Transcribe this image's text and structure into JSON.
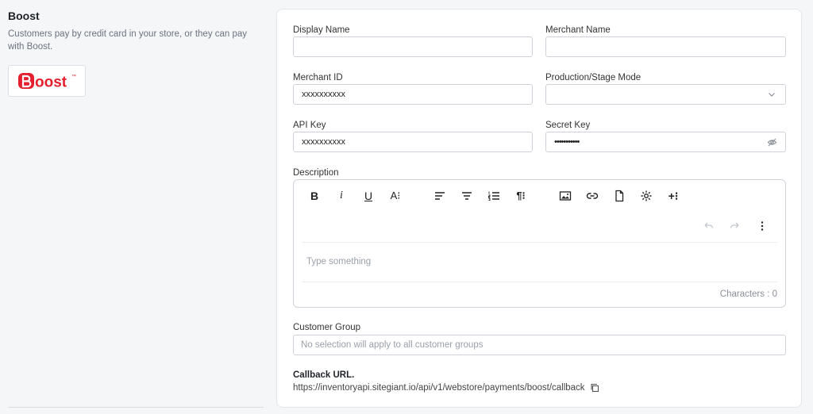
{
  "section": {
    "title": "Boost",
    "description": "Customers pay by credit card in your store, or they can pay with Boost.",
    "logo_text": "oost",
    "logo_tm": "™",
    "brand_color": "#e5202e"
  },
  "form": {
    "display_name": {
      "label": "Display Name",
      "value": ""
    },
    "merchant_name": {
      "label": "Merchant Name",
      "value": ""
    },
    "merchant_id": {
      "label": "Merchant ID",
      "value": "xxxxxxxxxx"
    },
    "mode": {
      "label": "Production/Stage Mode",
      "value": "",
      "icon": "chevron-down-icon"
    },
    "api_key": {
      "label": "API Key",
      "value": "xxxxxxxxxx"
    },
    "secret_key": {
      "label": "Secret Key",
      "value": "•••••••••••",
      "icon": "eye-off-icon"
    },
    "description": {
      "label": "Description",
      "placeholder": "Type something",
      "counter": "Characters : 0",
      "toolbar": [
        "bold-icon",
        "italic-icon",
        "underline-icon",
        "font-size-icon",
        "align-left-icon",
        "align-center-icon",
        "ordered-list-icon",
        "paragraph-icon",
        "image-icon",
        "link-icon",
        "file-icon",
        "settings-icon",
        "insert-more-icon",
        "undo-icon",
        "redo-icon",
        "more-vertical-icon"
      ],
      "toolbar_text": {
        "bold": "B",
        "italic": "i",
        "underline": "U",
        "font_size": "A⁝",
        "paragraph": "¶⁝",
        "insert": "+⁝"
      }
    },
    "customer_group": {
      "label": "Customer Group",
      "placeholder": "No selection will apply to all customer groups"
    },
    "callback": {
      "label": "Callback URL.",
      "url": "https://inventoryapi.sitegiant.io/api/v1/webstore/payments/boost/callback"
    }
  }
}
